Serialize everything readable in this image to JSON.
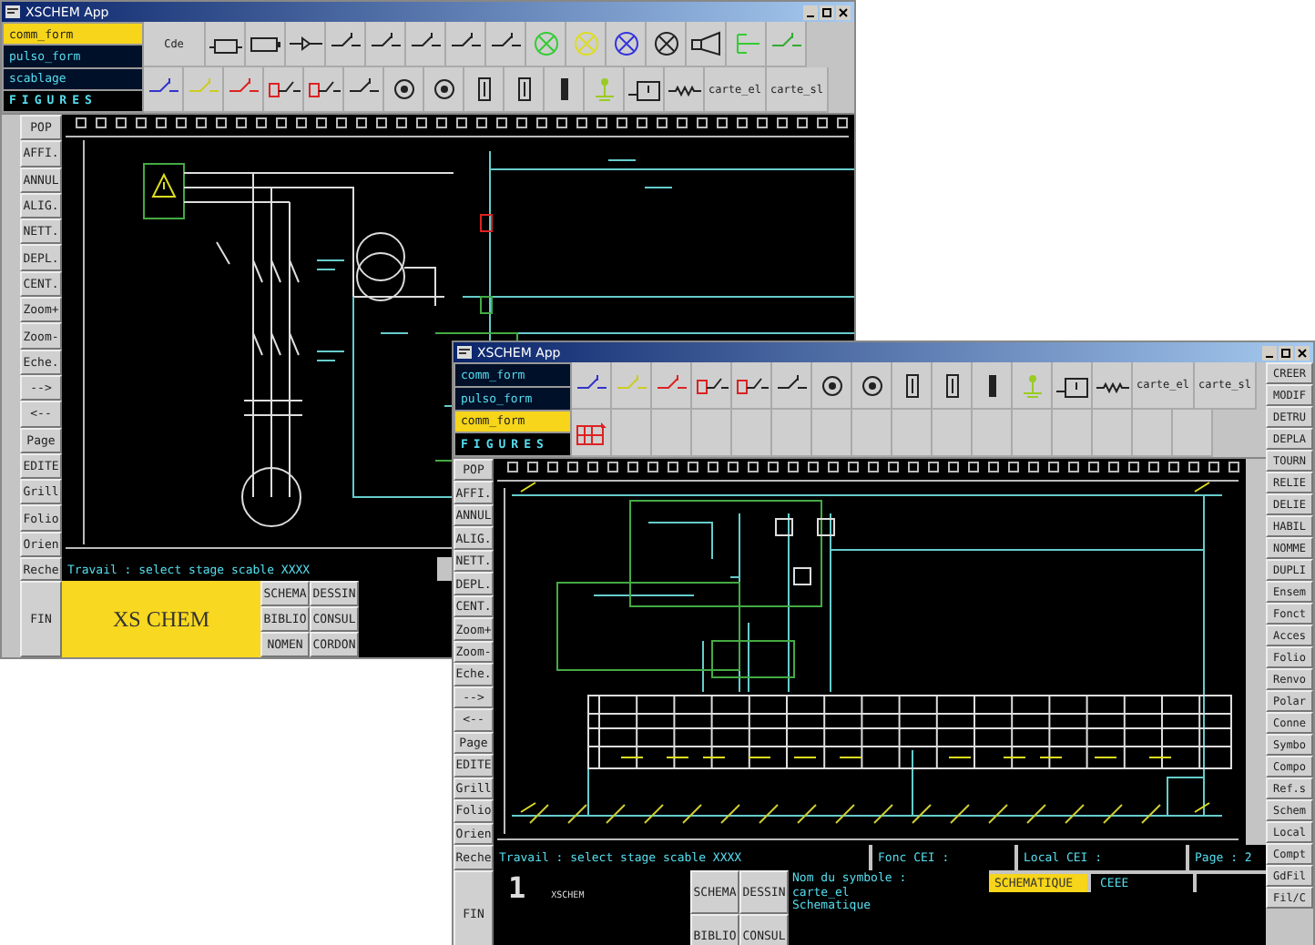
{
  "windows": [
    {
      "title": "XSCHEM App",
      "form_list": [
        {
          "label": "comm_form",
          "selected": true
        },
        {
          "label": "pulso_form",
          "selected": false
        },
        {
          "label": "scablage",
          "selected": false
        }
      ],
      "figures_label": "FIGURES",
      "toolbar_labels": [
        "Cde",
        "carte_el",
        "carte_sl"
      ],
      "left_buttons": [
        "POP",
        "AFFI.",
        "ANNUL",
        "ALIG.",
        "NETT.",
        "DEPL.",
        "CENT.",
        "Zoom+",
        "Zoom-",
        "Eche.",
        "-->",
        "<--",
        "Page",
        "EDITE",
        "Grill",
        "Folio",
        "Orien",
        "Reche",
        "FIN"
      ],
      "status_fields": [
        "Travail : select stage scable XXXX"
      ],
      "logo": "XS CHEM",
      "bottom_buttons": [
        "SCHEMA",
        "DESSIN",
        "BIBLIO",
        "CONSUL",
        "NOMEN",
        "CORDON"
      ]
    },
    {
      "title": "XSCHEM App",
      "form_list": [
        {
          "label": "comm_form",
          "selected": false
        },
        {
          "label": "pulso_form",
          "selected": false
        },
        {
          "label": "comm_form",
          "selected": true
        }
      ],
      "figures_label": "FIGURES",
      "toolbar_labels": [
        "carte_el",
        "carte_sl"
      ],
      "left_buttons": [
        "POP",
        "AFFI.",
        "ANNUL",
        "ALIG.",
        "NETT.",
        "DEPL.",
        "CENT.",
        "Zoom+",
        "Zoom-",
        "Eche.",
        "-->",
        "<--",
        "Page",
        "EDITE",
        "Grill",
        "Folio",
        "Orien",
        "Reche",
        "FIN"
      ],
      "right_buttons": [
        "CREER",
        "MODIF",
        "DETRU",
        "DEPLA",
        "TOURN",
        "RELIE",
        "DELIE",
        "HABIL",
        "NOMME",
        "DUPLI",
        "Ensem",
        "Fonct",
        "Acces",
        "Folio",
        "Renvo",
        "Polar",
        "Conne",
        "Symbo",
        "Compo",
        "Ref.s",
        "Schem",
        "Local",
        "Compt",
        "GdFil",
        "Fil/C"
      ],
      "status_fields": [
        "Travail : select stage scable XXXX",
        "Fonc CEI :",
        "Local CEI :",
        "Page : 2"
      ],
      "big_digit": "1",
      "small_logo": "XSCHEM",
      "bottom_buttons": [
        "SCHEMA",
        "DESSIN",
        "BIBLIO",
        "CONSUL"
      ],
      "symbol_info": [
        "Nom du symbole :",
        "carte_el",
        "Schematique"
      ],
      "mode_fields": [
        {
          "label": "SCHEMATIQUE",
          "selected": true
        },
        {
          "label": "CEEE",
          "selected": false
        }
      ]
    }
  ]
}
